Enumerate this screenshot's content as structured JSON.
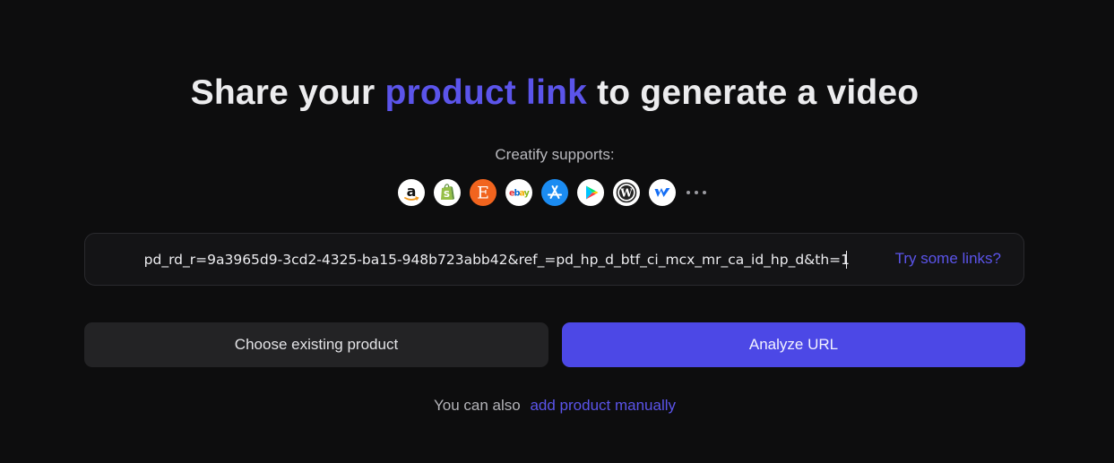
{
  "headline": {
    "prefix": "Share your ",
    "accent": "product link",
    "suffix": " to generate a video"
  },
  "supports_label": "Creatify supports:",
  "platforms": [
    {
      "name": "amazon-icon"
    },
    {
      "name": "shopify-icon"
    },
    {
      "name": "etsy-icon"
    },
    {
      "name": "ebay-icon"
    },
    {
      "name": "app-store-icon"
    },
    {
      "name": "google-play-icon"
    },
    {
      "name": "wordpress-icon"
    },
    {
      "name": "webflow-icon"
    },
    {
      "name": "more-icon"
    }
  ],
  "url_input": {
    "value": "pd_rd_r=9a3965d9-3cd2-4325-ba15-948b723abb42&ref_=pd_hp_d_btf_ci_mcx_mr_ca_id_hp_d&th=1"
  },
  "try_links_label": "Try some links?",
  "buttons": {
    "choose_existing": "Choose existing product",
    "analyze": "Analyze URL"
  },
  "footer": {
    "text": "You can also",
    "link": "add product manually"
  },
  "colors": {
    "background": "#0d0d0e",
    "accent": "#5b54ea",
    "primary_button": "#4c48e6",
    "secondary_button": "#232325"
  }
}
